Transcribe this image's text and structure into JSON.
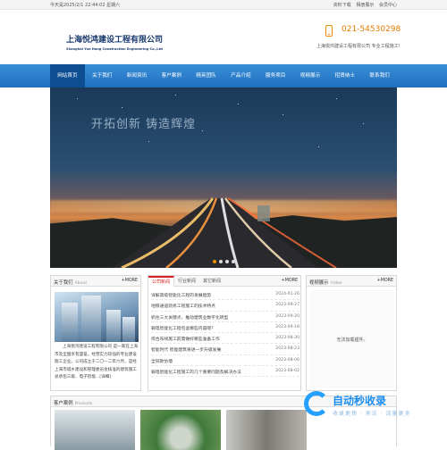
{
  "topbar": {
    "datetime": "今天是2025/2/1 22:44:02 星期六",
    "links": [
      "资料下载",
      "相册展示",
      "会员中心"
    ]
  },
  "header": {
    "logo_cn": "上海悦鸿建设工程有限公司",
    "logo_en": "Shanghai Yue Hong Construction Engineering Co.,Ltd",
    "phone": "021-54530298",
    "slogan": "上海悦鸿建设工程有限公司 专业工程施工！"
  },
  "nav": {
    "items": [
      "网站首页",
      "关于我们",
      "新闻资讯",
      "客户案例",
      "精英团队",
      "产品介绍",
      "服务项目",
      "视频展示",
      "招贤纳士",
      "联系我们"
    ]
  },
  "banner": {
    "text": "开拓创新  铸造辉煌",
    "active_slide": 1
  },
  "about": {
    "title": "关于我们",
    "title_en": "About",
    "more": "+MORE",
    "text": "上海悦鸿建设工程有限公司 是一家在上海市及全国享有盛誉，经营实力较强的专业建设施工企业。公司成立于二〇一二年六月，是经上海市城乡建设和管理委员会核准的建筑施工总承包三级、电子智能...[详细]"
  },
  "news": {
    "tabs": [
      "公司新闻",
      "行业新闻",
      "其它新闻"
    ],
    "more": "+MORE",
    "items": [
      {
        "title": "详解高级智能化工程的发展趋势",
        "date": "2024-01-26"
      },
      {
        "title": "地铁通道装修工程施工的技术特点",
        "date": "2023-09-27"
      },
      {
        "title": "抓住三大关键点，推动建筑业数字化转型",
        "date": "2023-09-20"
      },
      {
        "title": "弱电智能化工程包含哪些内容呢？",
        "date": "2023-09-18"
      },
      {
        "title": "综合布线施工前需做好哪些准备工作",
        "date": "2023-08-30"
      },
      {
        "title": "智能时代 智能建筑将进一步升级发展",
        "date": "2023-08-23"
      },
      {
        "title": "全同款仿墙",
        "date": "2023-08-06"
      },
      {
        "title": "弱电智能化工程施工的几个重要问题及解决办法",
        "date": "2023-08-02"
      }
    ]
  },
  "video": {
    "title": "视频展示",
    "title_en": "Video",
    "more": "+MORE",
    "empty": "无法加载插件。"
  },
  "cases": {
    "title": "客户案例",
    "title_en": "Products"
  },
  "watermark": {
    "title": "自动秒收录",
    "subtitle": "收录更快 · 来访 · 流量更多"
  }
}
